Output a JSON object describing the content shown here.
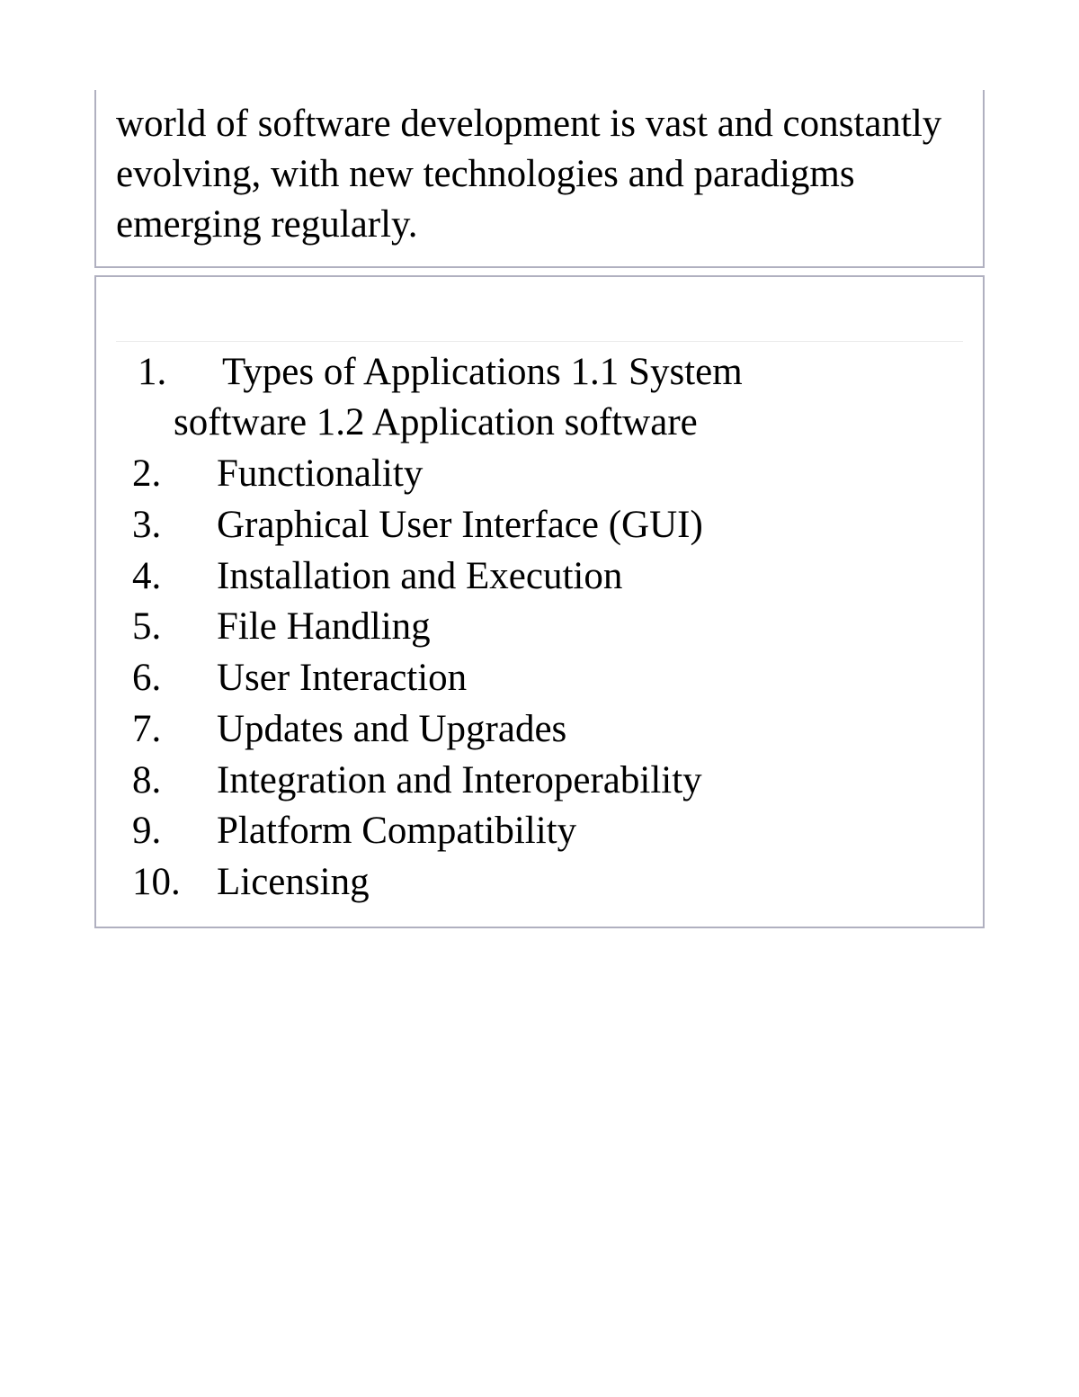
{
  "intro_paragraph": "world of software development is vast and constantly evolving, with new technologies and paradigms emerging regularly.",
  "toc": [
    {
      "num": "1.",
      "label_line1": "Types of Applications 1.1 System",
      "label_line2": "software 1.2 Application software"
    },
    {
      "num": "2.",
      "label": "Functionality"
    },
    {
      "num": "3.",
      "label": "Graphical User Interface (GUI)"
    },
    {
      "num": "4.",
      "label": "Installation and Execution"
    },
    {
      "num": "5.",
      "label": "File Handling"
    },
    {
      "num": "6.",
      "label": "User Interaction"
    },
    {
      "num": "7.",
      "label": "Updates and Upgrades"
    },
    {
      "num": "8.",
      "label": "Integration and Interoperability"
    },
    {
      "num": "9.",
      "label": "Platform Compatibility"
    },
    {
      "num": "10.",
      "label": "Licensing"
    }
  ]
}
